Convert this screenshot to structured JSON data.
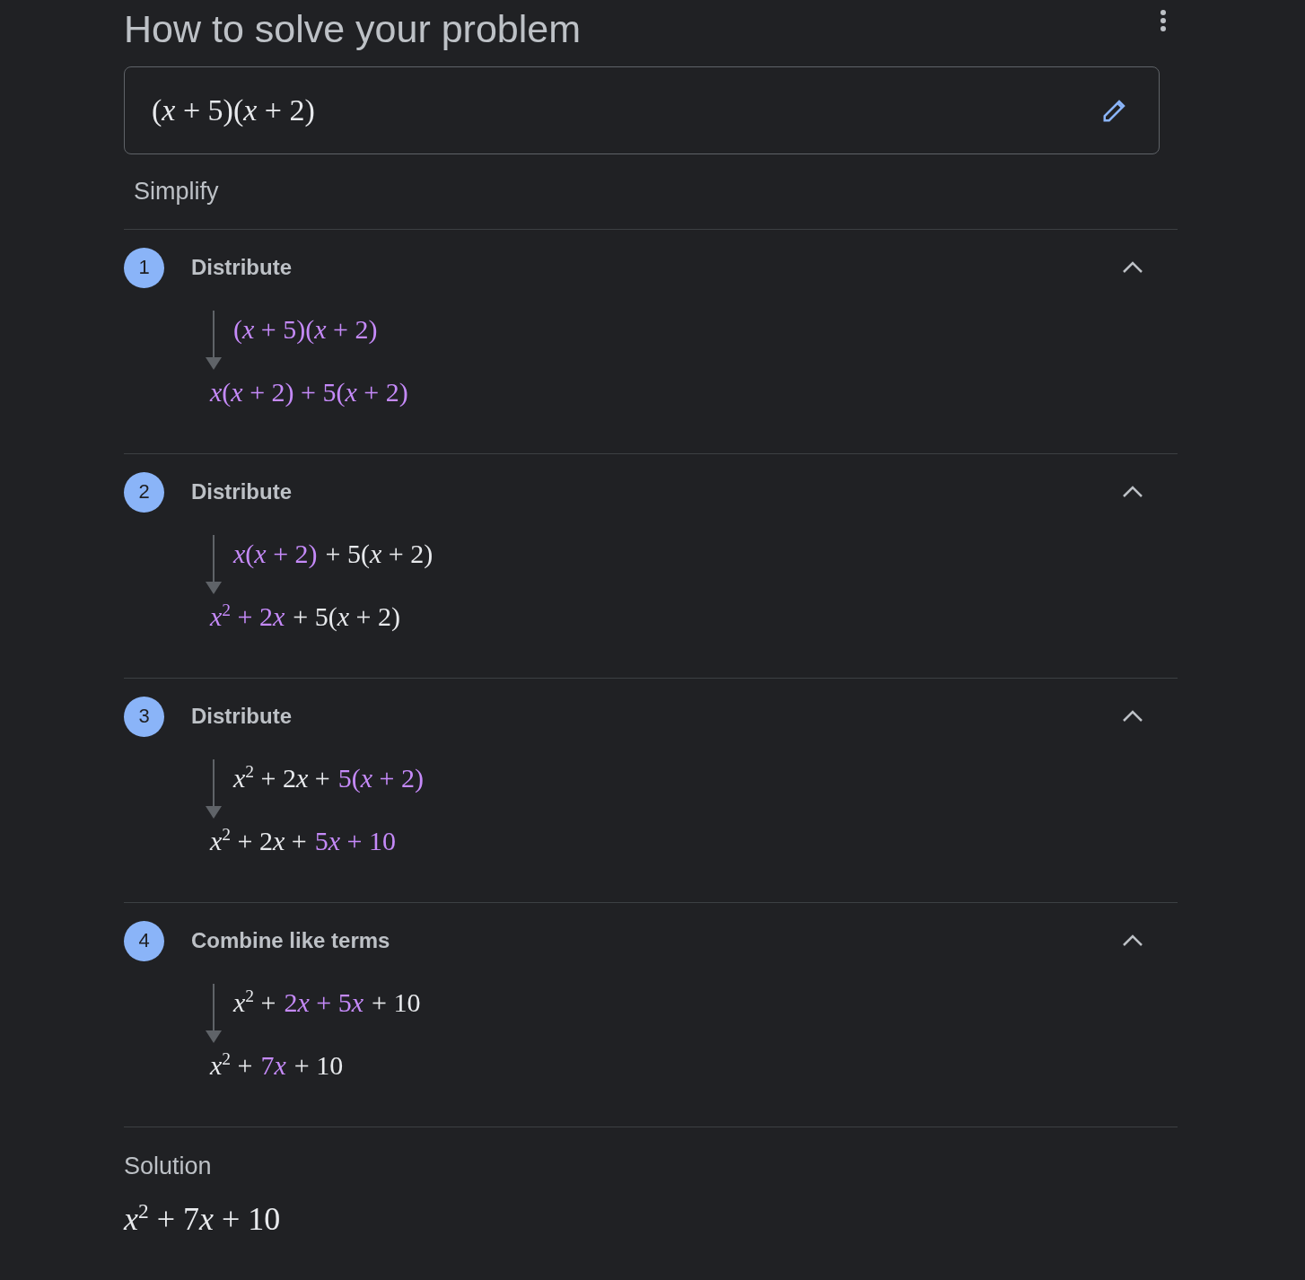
{
  "header": {
    "title": "How to solve your problem"
  },
  "problem": {
    "segments": [
      {
        "text": "(x + 5)(x + 2)",
        "highlight": false
      }
    ]
  },
  "method": "Simplify",
  "steps": [
    {
      "number": "1",
      "title": "Distribute",
      "expanded": true,
      "from": [
        {
          "text": "(x + 5)(x + 2)",
          "highlight": true
        }
      ],
      "to": [
        {
          "text": "x(x + 2) + 5(x + 2)",
          "highlight": true
        }
      ]
    },
    {
      "number": "2",
      "title": "Distribute",
      "expanded": true,
      "from": [
        {
          "text": "x(x + 2)",
          "highlight": true
        },
        {
          "text": "+ 5(x + 2)",
          "highlight": false
        }
      ],
      "to": [
        {
          "text": "x$^{2}$ + 2x",
          "highlight": true
        },
        {
          "text": "+ 5(x + 2)",
          "highlight": false
        }
      ]
    },
    {
      "number": "3",
      "title": "Distribute",
      "expanded": true,
      "from": [
        {
          "text": "x$^{2}$ + 2x +",
          "highlight": false
        },
        {
          "text": "5(x + 2)",
          "highlight": true
        }
      ],
      "to": [
        {
          "text": "x$^{2}$ + 2x +",
          "highlight": false
        },
        {
          "text": "5x + 10",
          "highlight": true
        }
      ]
    },
    {
      "number": "4",
      "title": "Combine like terms",
      "expanded": true,
      "from": [
        {
          "text": "x$^{2}$ +",
          "highlight": false
        },
        {
          "text": "2x + 5x",
          "highlight": true
        },
        {
          "text": "+ 10",
          "highlight": false
        }
      ],
      "to": [
        {
          "text": "x$^{2}$ +",
          "highlight": false
        },
        {
          "text": "7x",
          "highlight": true
        },
        {
          "text": "+ 10",
          "highlight": false
        }
      ]
    }
  ],
  "solution": {
    "label": "Solution",
    "segments": [
      {
        "text": "x$^{2}$ + 7x + 10",
        "highlight": false
      }
    ]
  }
}
